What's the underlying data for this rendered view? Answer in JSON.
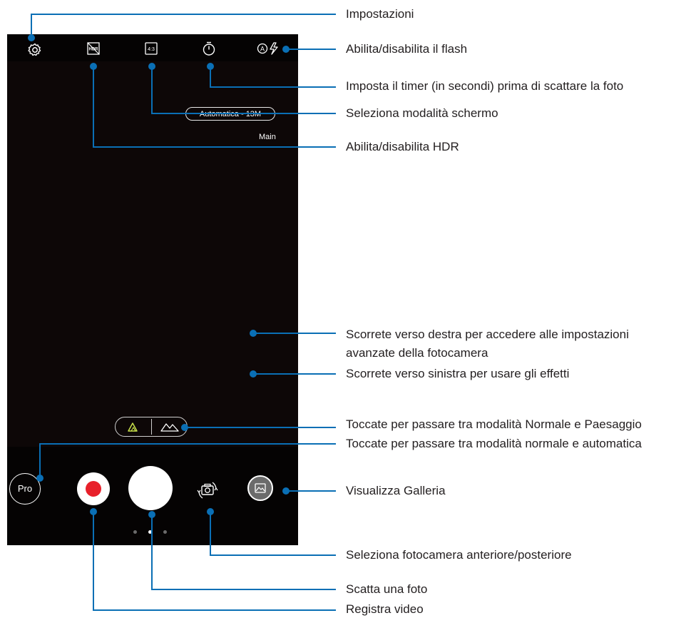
{
  "camera": {
    "resolution_label": "Automatica - 13M",
    "camera_label": "Main",
    "pro_label": "Pro",
    "top_icons": [
      "settings-gear-icon",
      "hdr-icon",
      "aspect-ratio-4-3-icon",
      "timer-icon",
      "auto-flash-icon"
    ],
    "aspect_ratio_text": "4:3",
    "hdr_text": "HDR",
    "mode_icons": [
      "normal-mode-icon",
      "landscape-mode-icon"
    ],
    "page_dots": 3,
    "active_dot": 1
  },
  "callouts": {
    "settings": "Impostazioni",
    "flash": "Abilita/disabilita il flash",
    "timer": "Imposta il timer (in secondi) prima di scattare la foto",
    "screen_mode": "Seleziona modalità schermo",
    "hdr": "Abilita/disabilita HDR",
    "swipe_right_1": "Scorrete verso destra per accedere alle impostazioni",
    "swipe_right_2": "avanzate della fotocamera",
    "swipe_left": "Scorrete verso sinistra per usare gli effetti",
    "normal_landscape": "Toccate per passare tra modalità Normale e Paesaggio",
    "normal_auto": "Toccate per passare tra modalità normale e automatica",
    "gallery": "Visualizza Galleria",
    "switch_camera": "Seleziona fotocamera anteriore/posteriore",
    "take_photo": "Scatta una foto",
    "record_video": "Registra video"
  },
  "colors": {
    "callout_blue": "#0a6fb5",
    "record_red": "#e8202a",
    "active_mode_green": "#c8e04a"
  }
}
